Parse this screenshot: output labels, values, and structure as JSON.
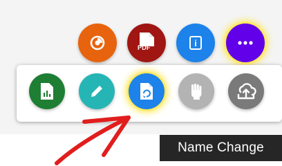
{
  "top_row": {
    "preview": {
      "icon": "eye-icon",
      "color": "#e8630e"
    },
    "pdf": {
      "icon": "pdf-file-icon",
      "label": "PDF",
      "color": "#a01612"
    },
    "info": {
      "icon": "info-icon",
      "label": "i",
      "color": "#1d82ea"
    },
    "more": {
      "icon": "more-dots-icon",
      "color": "#6200ea",
      "highlight": "#ffe54a"
    }
  },
  "tray": {
    "items": [
      {
        "name": "report",
        "icon": "spreadsheet-file-icon",
        "color": "#1e7e34"
      },
      {
        "name": "edit",
        "icon": "pencil-icon",
        "color": "#26b5b5"
      },
      {
        "name": "name-change",
        "icon": "file-rename-icon",
        "color": "#1d82ea",
        "highlighted": true
      },
      {
        "name": "permissions",
        "icon": "raised-fist-icon",
        "color": "#b3b3b3"
      },
      {
        "name": "upload",
        "icon": "cloud-upload-icon",
        "color": "#7a7a7a"
      }
    ]
  },
  "tooltip": {
    "text": "Name Change"
  },
  "annotation": {
    "arrow_color": "#e01e1e"
  }
}
